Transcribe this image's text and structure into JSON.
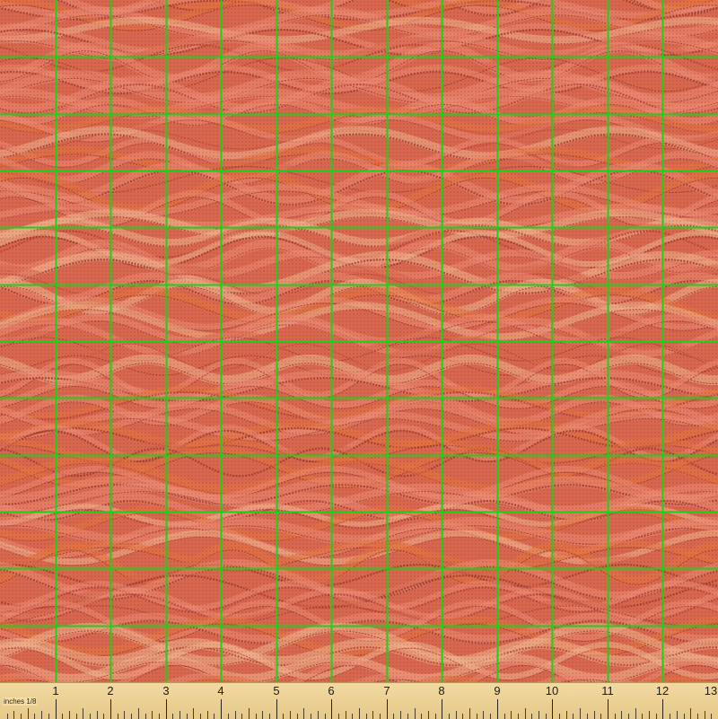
{
  "fabric": {
    "colors": {
      "background": "#d9674f",
      "wave_light": "#ec8a72",
      "wave_dark": "#b8413a",
      "wave_orange": "#e3723f",
      "highlight": "#f1b58e",
      "stitch": "#9c3a30",
      "grid_line": "#19d219"
    },
    "grid_columns": 13,
    "grid_rows": 12
  },
  "ruler": {
    "unit_label": "inches 1/8",
    "numbers": [
      "1",
      "2",
      "3",
      "4",
      "5",
      "6",
      "7",
      "8",
      "9",
      "10",
      "11",
      "12",
      "13"
    ],
    "background": "#f1d9a0"
  }
}
